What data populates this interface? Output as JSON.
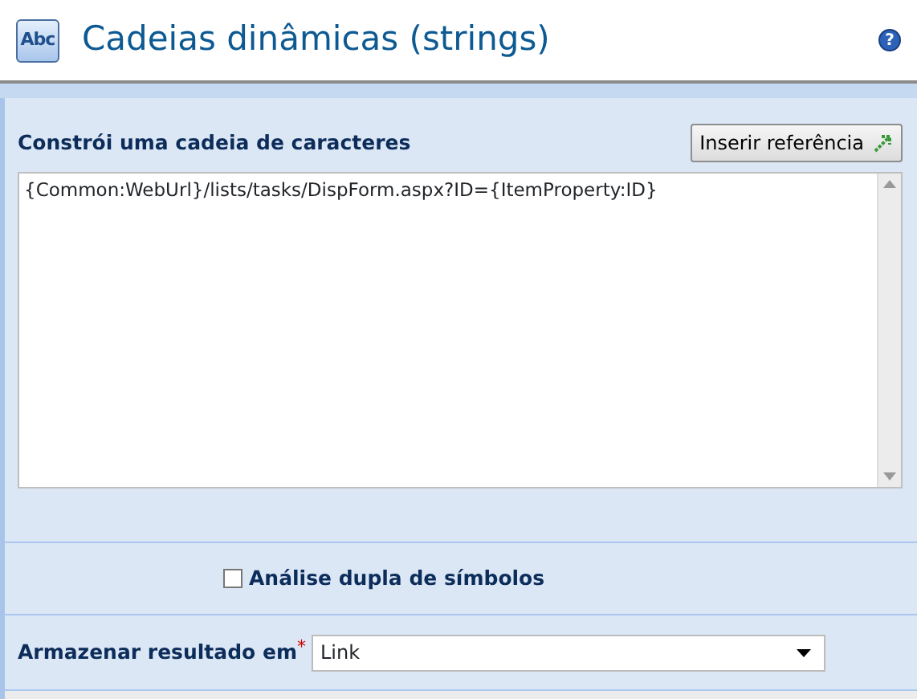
{
  "header": {
    "logo": "Abc",
    "title": "Cadeias dinâmicas (strings)",
    "help": "?"
  },
  "builder": {
    "label": "Constrói uma cadeia de caracteres",
    "insert_button": "Inserir referência",
    "value": "{Common:WebUrl}/lists/tasks/DispForm.aspx?ID={ItemProperty:ID}"
  },
  "options": [
    {
      "label": "Análise dupla de símbolos",
      "checked": false
    }
  ],
  "store": {
    "label": "Armazenar resultado em",
    "required": "*",
    "value": "Link"
  }
}
